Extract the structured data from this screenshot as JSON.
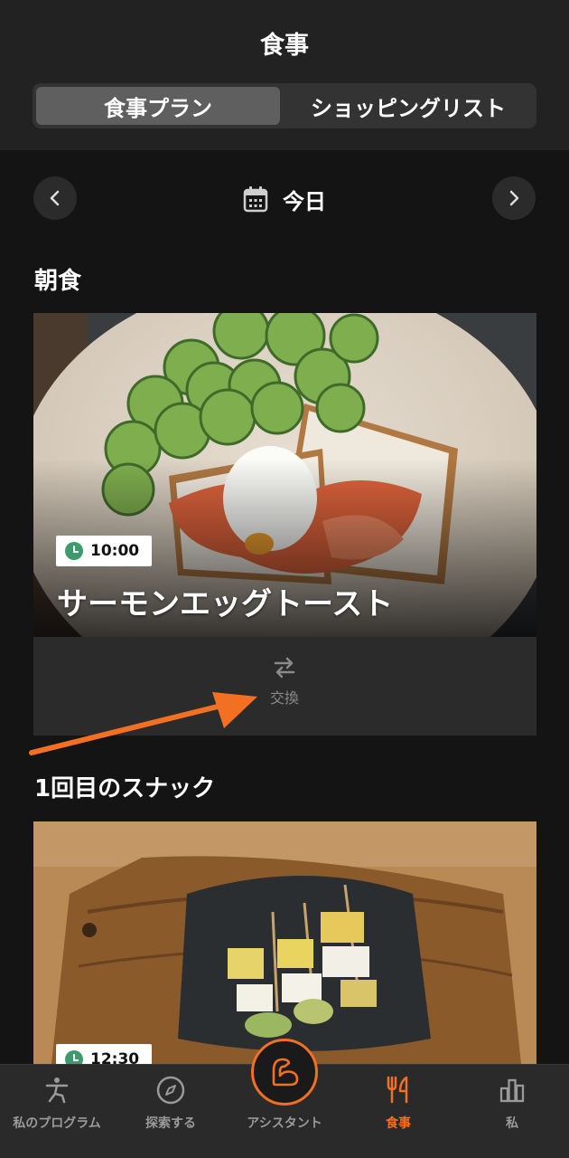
{
  "header": {
    "title": "食事",
    "tabs": [
      {
        "label": "食事プラン",
        "active": true
      },
      {
        "label": "ショッピングリスト",
        "active": false
      }
    ]
  },
  "date_nav": {
    "prev_icon": "chevron-left-icon",
    "next_icon": "chevron-right-icon",
    "calendar_icon": "calendar-icon",
    "label": "今日"
  },
  "sections": [
    {
      "title": "朝食",
      "meal": {
        "time": "10:00",
        "name": "サーモンエッグトースト",
        "swap_label": "交換"
      }
    },
    {
      "title": "1回目のスナック",
      "meal": {
        "time": "12:30"
      }
    }
  ],
  "bottom_nav": {
    "tabs": [
      {
        "label": "私のプログラム",
        "icon": "exercise-figure-icon",
        "active": false
      },
      {
        "label": "探索する",
        "icon": "compass-icon",
        "active": false
      },
      {
        "label": "アシスタント",
        "icon": "flexed-arm-icon",
        "active": false
      },
      {
        "label": "食事",
        "icon": "fork-knife-icon",
        "active": true
      },
      {
        "label": "私",
        "icon": "bar-chart-icon",
        "active": false
      }
    ]
  },
  "colors": {
    "accent": "#f36f21",
    "background": "#141414",
    "header_bg": "#222222",
    "clock_green": "#3e9a6d"
  }
}
